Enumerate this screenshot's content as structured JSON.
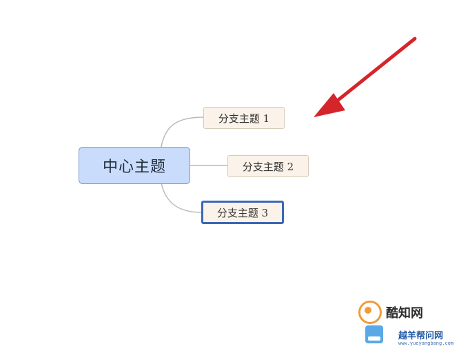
{
  "mindmap": {
    "central_topic": "中心主题",
    "branches": [
      {
        "label": "分支主题 1",
        "selected": false
      },
      {
        "label": "分支主题 2",
        "selected": false
      },
      {
        "label": "分支主题 3",
        "selected": true
      }
    ]
  },
  "annotation": {
    "arrow_color": "#d6242b",
    "points_to": "分支主题 1"
  },
  "watermark": {
    "line1": "酷知网",
    "line2": "越羊帮问网",
    "line3": "www.yueyangbang.com"
  },
  "colors": {
    "central_fill": "#c9dcfb",
    "branch_fill": "#fbf3ea",
    "selection_border": "#3b67b5"
  }
}
